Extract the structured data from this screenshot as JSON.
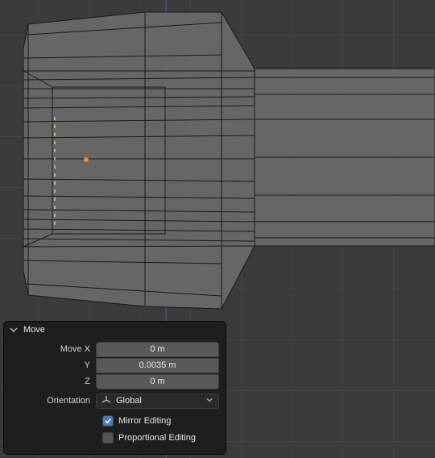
{
  "panel": {
    "title": "Move",
    "x_label": "Move X",
    "y_label": "Y",
    "z_label": "Z",
    "x_value": "0 m",
    "y_value": "0.0035 m",
    "z_value": "0 m",
    "orientation_label": "Orientation",
    "orientation_value": "Global",
    "mirror_label": "Mirror Editing",
    "mirror_checked": true,
    "proportional_label": "Proportional Editing",
    "proportional_checked": false
  },
  "icons": {
    "disclosure": "disclosure-triangle",
    "orientation": "axes-icon",
    "dropdown": "chevron-down",
    "check": "check-mark"
  }
}
